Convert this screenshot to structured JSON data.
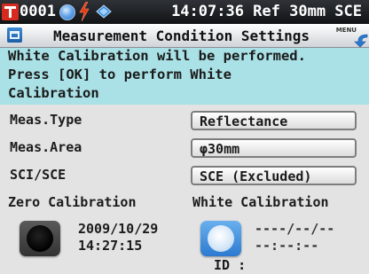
{
  "status_bar": {
    "sample_no": "0001",
    "time_ref": "14:07:36 Ref 30mm SCE",
    "icons": [
      "target-icon",
      "lens-icon",
      "bolt-icon",
      "diamond-icon"
    ],
    "colors": {
      "target": "#d62a1e",
      "bolt": "#e23a1a",
      "lens": "#4a90d9"
    }
  },
  "title_bar": {
    "title": "Measurement Condition Settings",
    "menu_label": "MENU"
  },
  "message": {
    "lines": [
      "White Calibration will be performed.",
      "Press [OK] to perform White",
      "Calibration"
    ],
    "background": "#a9e1e6"
  },
  "settings": {
    "meas_type": {
      "label": "Meas.Type",
      "value": "Reflectance"
    },
    "meas_area": {
      "label": "Meas.Area",
      "value": "φ30mm"
    },
    "sci_sce": {
      "label": "SCI/SCE",
      "value": "SCE (Excluded)"
    }
  },
  "zero_calibration": {
    "heading": "Zero Calibration",
    "date": "2009/10/29",
    "time": "14:27:15"
  },
  "white_calibration": {
    "heading": "White Calibration",
    "date": "----/--/--",
    "time": "--:--:--",
    "id": "ID :"
  }
}
